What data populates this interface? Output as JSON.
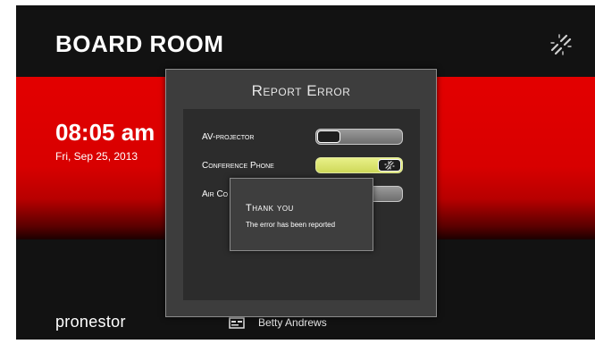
{
  "room": {
    "title": "BOARD ROOM"
  },
  "clock": {
    "time": "08:05 am",
    "date": "Fri, Sep 25, 2013"
  },
  "footer": {
    "brand": "pronestor",
    "host_name": "Betty Andrews"
  },
  "dialog": {
    "title": "Report Error",
    "devices": [
      {
        "label": "AV-projector",
        "state": "off"
      },
      {
        "label": "Conference Phone",
        "state": "on"
      },
      {
        "label": "Air Co",
        "state": "off"
      }
    ]
  },
  "toast": {
    "title": "Thank you",
    "message": "The error has been reported"
  },
  "icons": {
    "top_right": "broken-link-icon",
    "toggle_on": "broken-link-icon",
    "host": "id-card-icon"
  },
  "colors": {
    "accent_red": "#e30000",
    "toggle_on": "#dde473",
    "background": "#121212"
  }
}
